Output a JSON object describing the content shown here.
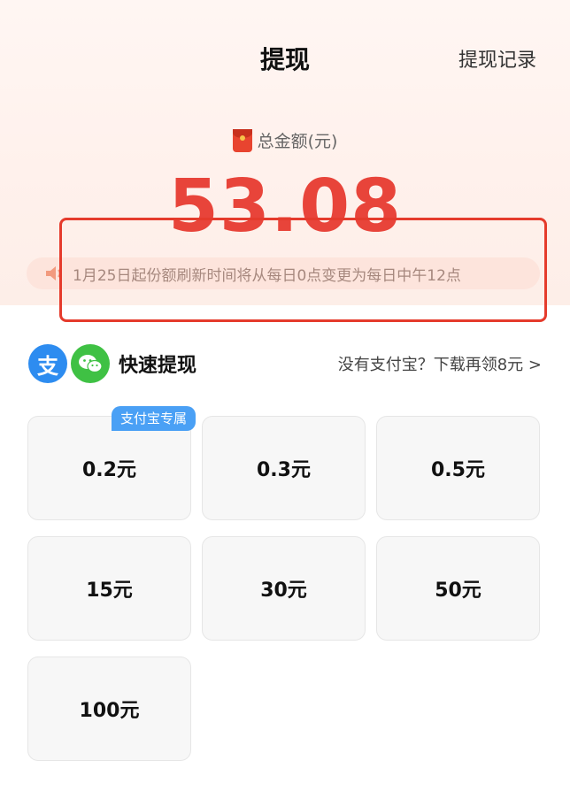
{
  "header": {
    "title": "提现",
    "record_link": "提现记录"
  },
  "balance": {
    "label": "总金额(元)",
    "amount": "53.08",
    "icon": "red-packet-icon"
  },
  "notice": {
    "icon": "speaker-icon",
    "text": "1月25日起份额刷新时间将从每日0点变更为每日中午12点"
  },
  "quick": {
    "alipay_glyph": "支",
    "title": "快速提现",
    "link": "没有支付宝？下载再领8元 >"
  },
  "options": [
    {
      "label": "0.2元",
      "badge": "支付宝专属"
    },
    {
      "label": "0.3元"
    },
    {
      "label": "0.5元"
    },
    {
      "label": "15元"
    },
    {
      "label": "30元"
    },
    {
      "label": "50元"
    },
    {
      "label": "100元"
    }
  ],
  "colors": {
    "accent_red": "#e8443a",
    "highlight_border": "#e53b2c",
    "alipay_blue": "#2d8cf0",
    "wechat_green": "#3fc144",
    "badge_blue": "#4aa0f5"
  }
}
